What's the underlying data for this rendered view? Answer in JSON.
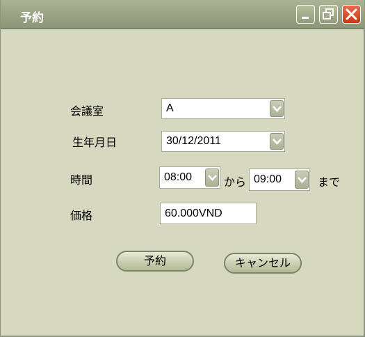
{
  "window": {
    "title": "予約"
  },
  "form": {
    "room_label": "会議室",
    "room_value": "A",
    "date_label": "生年月日",
    "date_value": "30/12/2011",
    "time_label": "時間",
    "time_from": "08:00",
    "from_text": "から",
    "time_to": "09:00",
    "to_text": "まで",
    "price_label": "価格",
    "price_value": "60.000VND"
  },
  "buttons": {
    "reserve": "予約",
    "cancel": "キャンセル"
  },
  "icons": {
    "minimize": "minimize-icon",
    "maximize": "restore-icon",
    "close": "close-icon",
    "dropdown": "chevron-down-icon"
  },
  "colors": {
    "titlebar": "#99a384",
    "background": "#d6d8c0",
    "close": "#d84a2a"
  }
}
